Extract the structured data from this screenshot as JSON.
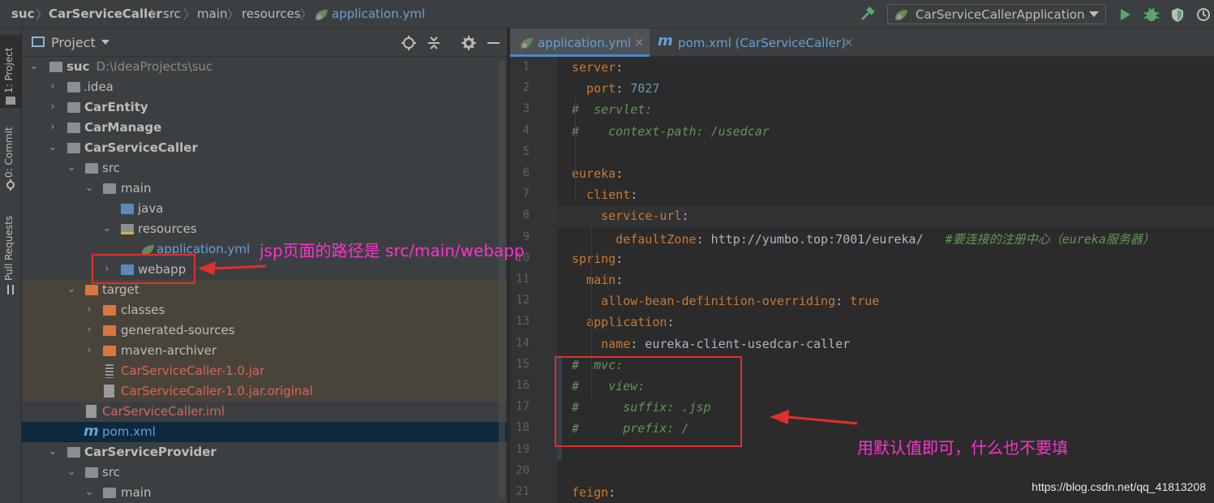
{
  "breadcrumb": {
    "items": [
      "suc",
      "CarServiceCaller",
      "src",
      "main",
      "resources",
      "application.yml"
    ]
  },
  "toolbar": {
    "run_config": "CarServiceCallerApplication"
  },
  "stripe": {
    "project": "1: Project",
    "commit": "0: Commit",
    "pull_requests": "Pull Requests"
  },
  "project_panel": {
    "title": "Project",
    "tree": [
      {
        "label": "suc",
        "path": "D:\\IdeaProjects\\suc",
        "bold": true
      },
      {
        "label": ".idea"
      },
      {
        "label": "CarEntity",
        "bold": true
      },
      {
        "label": "CarManage",
        "bold": true
      },
      {
        "label": "CarServiceCaller",
        "bold": true
      },
      {
        "label": "src"
      },
      {
        "label": "main"
      },
      {
        "label": "java"
      },
      {
        "label": "resources"
      },
      {
        "label": "application.yml"
      },
      {
        "label": "webapp"
      },
      {
        "label": "target"
      },
      {
        "label": "classes"
      },
      {
        "label": "generated-sources"
      },
      {
        "label": "maven-archiver"
      },
      {
        "label": "CarServiceCaller-1.0.jar"
      },
      {
        "label": "CarServiceCaller-1.0.jar.original"
      },
      {
        "label": "CarServiceCaller.iml"
      },
      {
        "label": "pom.xml"
      },
      {
        "label": "CarServiceProvider",
        "bold": true
      },
      {
        "label": "src"
      },
      {
        "label": "main"
      }
    ]
  },
  "editor": {
    "tabs": [
      {
        "label": "application.yml",
        "active": true
      },
      {
        "label": "pom.xml (CarServiceCaller)",
        "active": false
      }
    ],
    "lines": [
      {
        "n": "1",
        "parts": [
          [
            "k",
            "server"
          ],
          [
            "v",
            ":"
          ]
        ]
      },
      {
        "n": "2",
        "parts": [
          [
            "k",
            "  port"
          ],
          [
            "v",
            ": "
          ],
          [
            "n",
            "7027"
          ]
        ]
      },
      {
        "n": "3",
        "parts": [
          [
            "c",
            "#  servlet:"
          ]
        ]
      },
      {
        "n": "4",
        "parts": [
          [
            "c",
            "#    context-path: /usedcar"
          ]
        ]
      },
      {
        "n": "5",
        "parts": []
      },
      {
        "n": "6",
        "parts": [
          [
            "k",
            "eureka"
          ],
          [
            "v",
            ":"
          ]
        ]
      },
      {
        "n": "7",
        "parts": [
          [
            "k",
            "  client"
          ],
          [
            "v",
            ":"
          ]
        ]
      },
      {
        "n": "8",
        "parts": [
          [
            "k",
            "    service-url"
          ],
          [
            "v",
            ":"
          ]
        ]
      },
      {
        "n": "9",
        "parts": [
          [
            "k",
            "      defaultZone"
          ],
          [
            "v",
            ": http://yumbo.top:7001/eureka/   "
          ],
          [
            "c",
            "#要连接的注册中心（eureka服务器）"
          ]
        ]
      },
      {
        "n": "10",
        "parts": [
          [
            "k",
            "spring"
          ],
          [
            "v",
            ":"
          ]
        ]
      },
      {
        "n": "11",
        "parts": [
          [
            "k",
            "  main"
          ],
          [
            "v",
            ":"
          ]
        ]
      },
      {
        "n": "12",
        "parts": [
          [
            "k",
            "    allow-bean-definition-overriding"
          ],
          [
            "v",
            ": "
          ],
          [
            "k",
            "true"
          ]
        ]
      },
      {
        "n": "13",
        "parts": [
          [
            "k",
            "  application"
          ],
          [
            "v",
            ":"
          ]
        ]
      },
      {
        "n": "14",
        "parts": [
          [
            "k",
            "    name"
          ],
          [
            "v",
            ": eureka-client-usedcar-caller"
          ]
        ]
      },
      {
        "n": "15",
        "parts": [
          [
            "c",
            "#  mvc:"
          ]
        ]
      },
      {
        "n": "16",
        "parts": [
          [
            "c",
            "#    view:"
          ]
        ]
      },
      {
        "n": "17",
        "parts": [
          [
            "c",
            "#      suffix: .jsp"
          ]
        ]
      },
      {
        "n": "18",
        "parts": [
          [
            "c",
            "#      prefix: /"
          ]
        ]
      },
      {
        "n": "19",
        "parts": []
      },
      {
        "n": "20",
        "parts": []
      },
      {
        "n": "21",
        "parts": [
          [
            "k",
            "feign"
          ],
          [
            "v",
            ":"
          ]
        ]
      }
    ]
  },
  "annotations": {
    "webapp_note": "jsp页面的路径是 src/main/webapp",
    "default_note": "用默认值即可，什么也不要填"
  },
  "watermark": "https://blog.csdn.net/qq_41813208",
  "colors": {
    "keyword": "#cc7832",
    "comment": "#629755",
    "number": "#6897bb",
    "annotation": "#ff30d0",
    "highlight_box": "#e0302c"
  }
}
